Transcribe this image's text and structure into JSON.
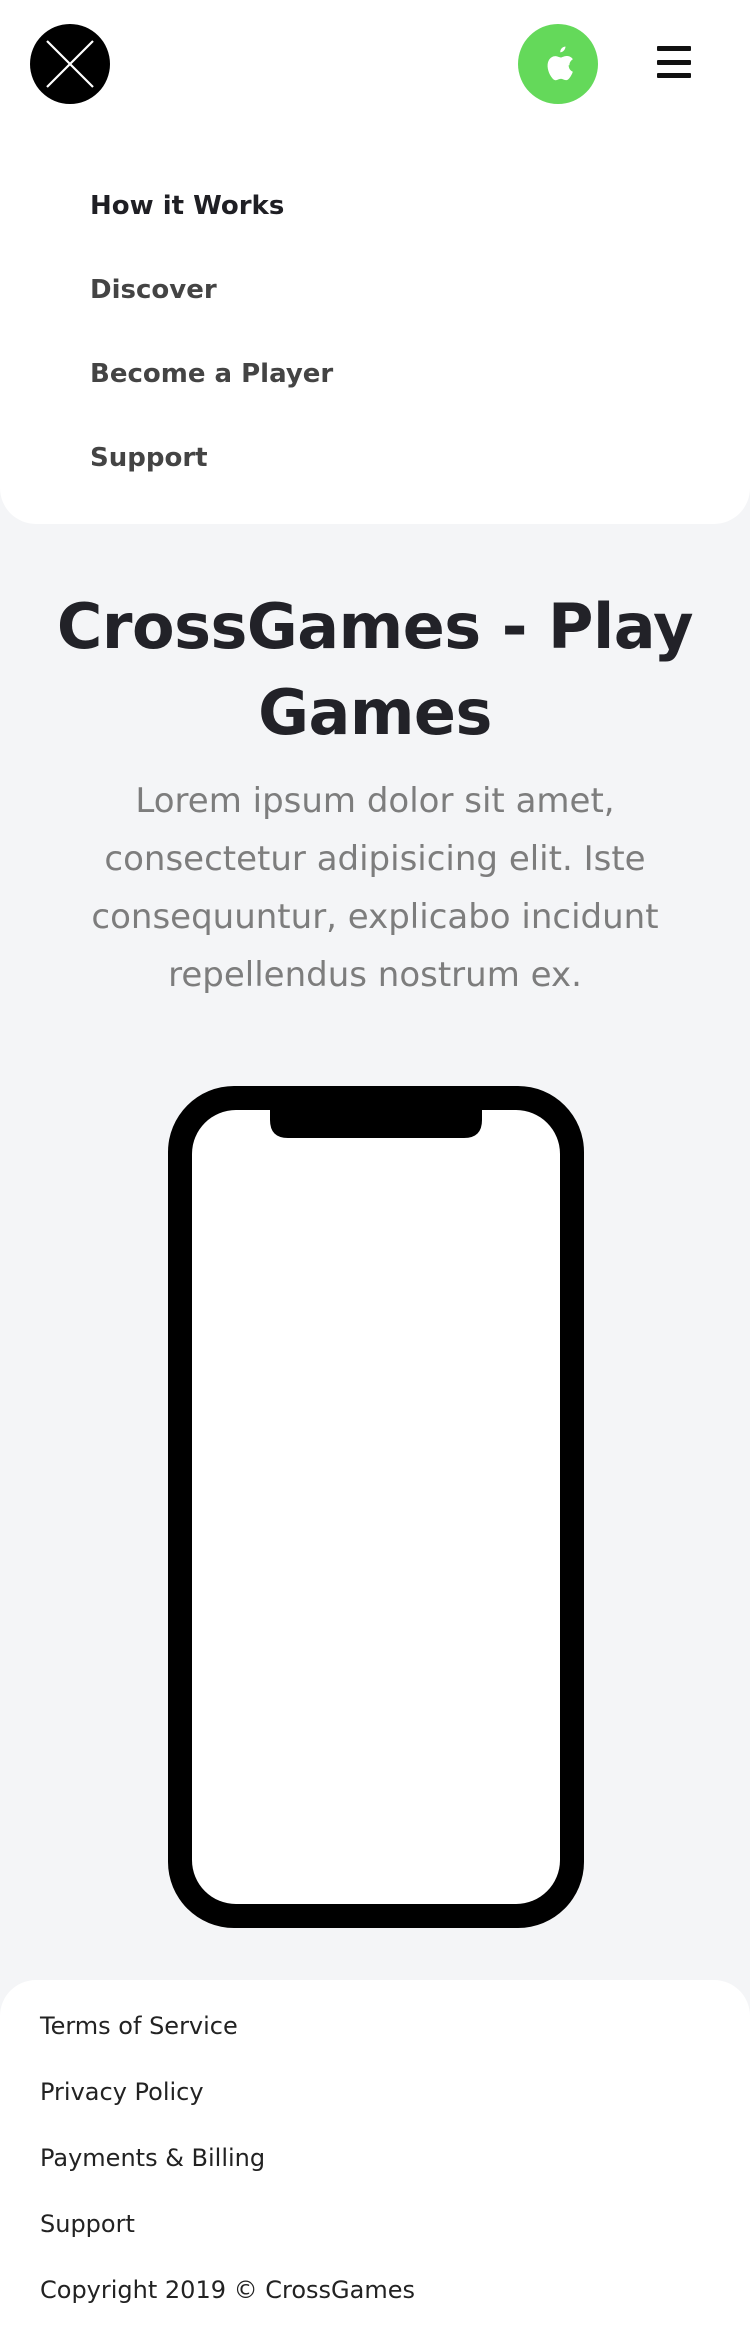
{
  "header": {
    "logo_icon": "x-circle-logo-icon",
    "app_store_icon": "apple-icon",
    "menu_icon": "hamburger-menu-icon",
    "accent_color": "#64d95a"
  },
  "nav": {
    "items": [
      {
        "label": "How it Works"
      },
      {
        "label": "Discover"
      },
      {
        "label": "Become a Player"
      },
      {
        "label": "Support"
      }
    ]
  },
  "hero": {
    "title": "CrossGames - Play Games",
    "description": "Lorem ipsum dolor sit amet, consectetur adipisicing elit. Iste consequuntur, explicabo incidunt repellendus nostrum ex."
  },
  "footer": {
    "links": [
      {
        "label": "Terms of Service"
      },
      {
        "label": "Privacy Policy"
      },
      {
        "label": "Payments & Billing"
      },
      {
        "label": "Support"
      }
    ],
    "copyright": "Copyright 2019 © CrossGames"
  }
}
